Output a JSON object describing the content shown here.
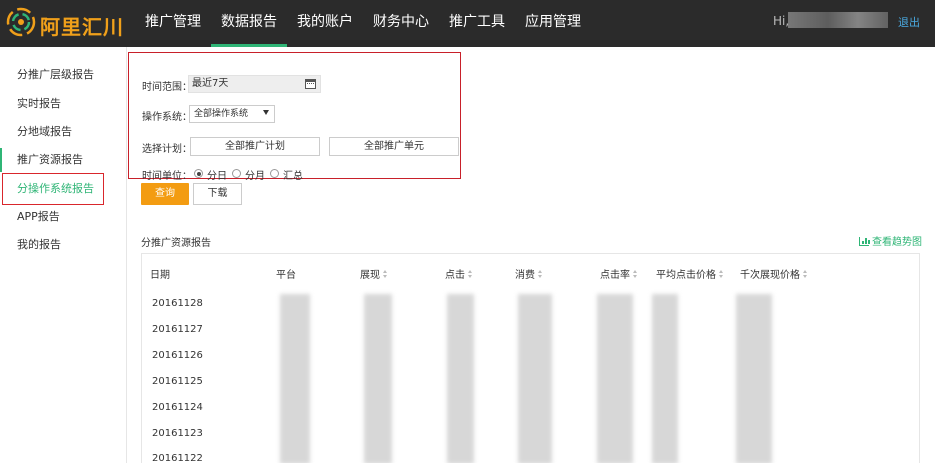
{
  "brand": {
    "name": "阿里汇川",
    "colors": {
      "topbar": "#2b2b2b",
      "accent": "#2fb576",
      "logo": "#f0a01a",
      "query_button": "#f39c12",
      "highlight_box": "#d9262c"
    }
  },
  "nav": {
    "items": [
      {
        "label": "推广管理"
      },
      {
        "label": "数据报告",
        "active": true
      },
      {
        "label": "我的账户"
      },
      {
        "label": "财务中心"
      },
      {
        "label": "推广工具"
      },
      {
        "label": "应用管理"
      }
    ]
  },
  "user": {
    "greeting": "Hi,",
    "logout_label": "退出"
  },
  "sidebar": {
    "items": [
      {
        "label": "分推广层级报告"
      },
      {
        "label": "实时报告"
      },
      {
        "label": "分地域报告"
      },
      {
        "label": "推广资源报告"
      },
      {
        "label": "分操作系统报告",
        "active": true
      },
      {
        "label": "APP报告"
      },
      {
        "label": "我的报告"
      }
    ]
  },
  "filters": {
    "time_range_label": "时间范围：",
    "time_range_value": "最近7天",
    "os_label": "操作系统：",
    "os_value": "全部操作系统",
    "plan_label": "选择计划：",
    "plan_button": "全部推广计划",
    "unit_button": "全部推广单元",
    "time_unit_label": "时间单位：",
    "time_unit_options": [
      "分日",
      "分月",
      "汇总"
    ],
    "time_unit_selected": "分日"
  },
  "actions": {
    "query_label": "查询",
    "download_label": "下载"
  },
  "report": {
    "title": "分推广资源报告",
    "trend_link": "查看趋势图",
    "columns": [
      "日期",
      "平台",
      "展现",
      "点击",
      "消费",
      "点击率",
      "平均点击价格",
      "千次展现价格"
    ],
    "rows": [
      "20161128",
      "20161127",
      "20161126",
      "20161125",
      "20161124",
      "20161123",
      "20161122"
    ]
  }
}
